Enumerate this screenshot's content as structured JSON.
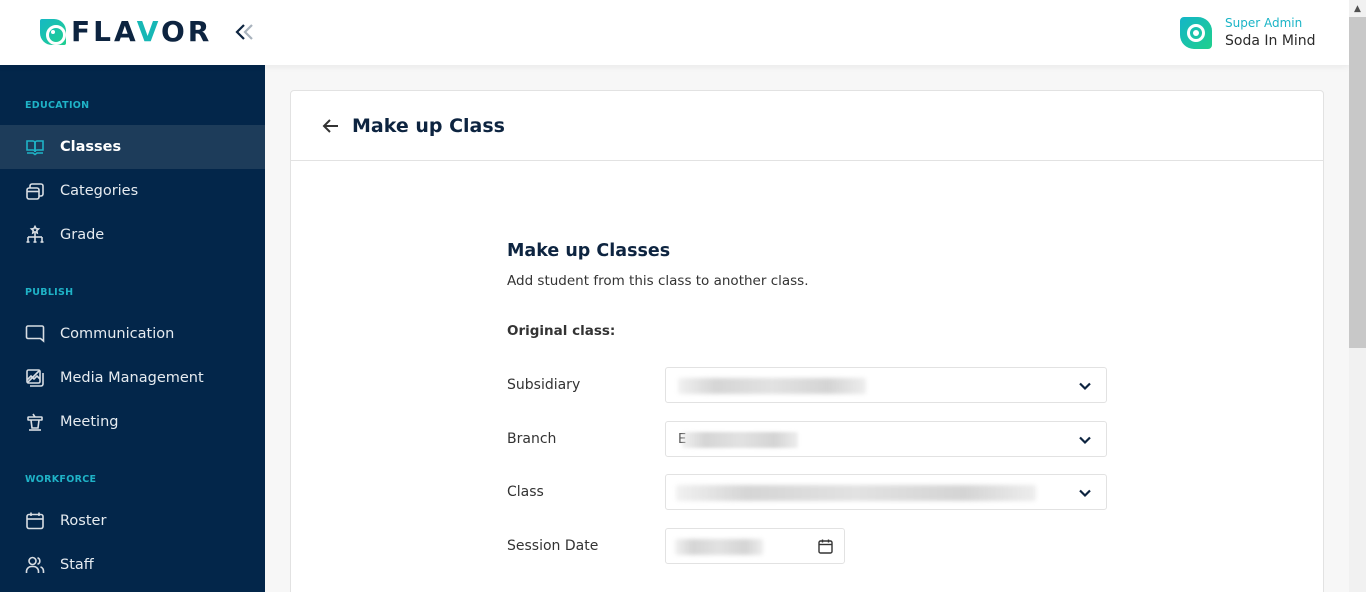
{
  "header": {
    "brand": {
      "prefix": "FLA",
      "accent": "V",
      "suffix": "OR"
    },
    "collapse_icon": "double-chevron-left-icon",
    "user": {
      "role": "Super Admin",
      "name": "Soda In Mind",
      "avatar_icon": "leaf-ring-logo-icon"
    }
  },
  "sidebar": {
    "sections": [
      {
        "label": "EDUCATION",
        "items": [
          {
            "label": "Classes",
            "icon": "open-book-icon",
            "active": true
          },
          {
            "label": "Categories",
            "icon": "stacked-cards-icon",
            "active": false
          },
          {
            "label": "Grade",
            "icon": "hierarchy-icon",
            "active": false
          }
        ]
      },
      {
        "label": "PUBLISH",
        "items": [
          {
            "label": "Communication",
            "icon": "chat-bubble-icon",
            "active": false
          },
          {
            "label": "Media Management",
            "icon": "image-gallery-icon",
            "active": false
          },
          {
            "label": "Meeting",
            "icon": "podium-icon",
            "active": false
          }
        ]
      },
      {
        "label": "WORKFORCE",
        "items": [
          {
            "label": "Roster",
            "icon": "calendar-icon",
            "active": false
          },
          {
            "label": "Staff",
            "icon": "users-icon",
            "active": false
          }
        ]
      }
    ]
  },
  "page": {
    "title": "Make up Class",
    "back_icon": "arrow-left-icon"
  },
  "form": {
    "title": "Make up Classes",
    "subtitle": "Add student from this class to another class.",
    "section_label": "Original class:",
    "fields": [
      {
        "label": "Subsidiary",
        "type": "select",
        "value": "(blurred)"
      },
      {
        "label": "Branch",
        "type": "select",
        "value": "E(blurred)"
      },
      {
        "label": "Class",
        "type": "select",
        "value": "(blurred)"
      },
      {
        "label": "Session Date",
        "type": "date",
        "value": "(blurred)"
      }
    ],
    "branch_visible_char": "E"
  },
  "colors": {
    "sidebar_bg": "#03264a",
    "sidebar_active_bg": "#1d3c5a",
    "accent": "#1ab4c6",
    "title": "#0d2440"
  }
}
